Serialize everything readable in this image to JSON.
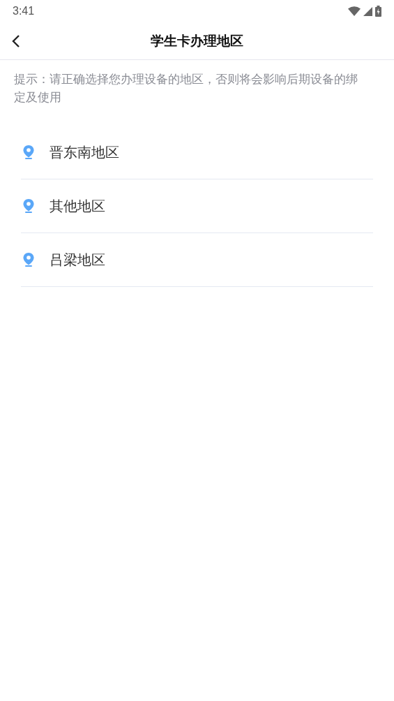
{
  "status_bar": {
    "time": "3:41"
  },
  "header": {
    "title": "学生卡办理地区"
  },
  "hint": "提示：请正确选择您办理设备的地区，否则将会影响后期设备的绑定及使用",
  "regions": [
    {
      "name": "晋东南地区"
    },
    {
      "name": "其他地区"
    },
    {
      "name": "吕梁地区"
    }
  ]
}
